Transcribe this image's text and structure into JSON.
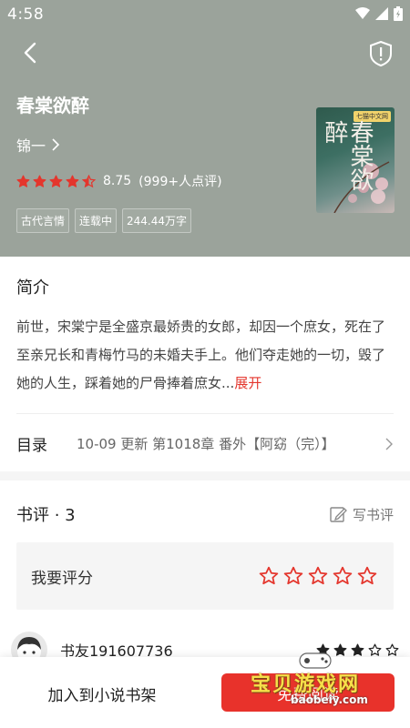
{
  "status": {
    "time": "4:58"
  },
  "book": {
    "title": "春棠欲醉",
    "author": "锦一",
    "score": "8.75",
    "rating_count": "(999+人点评)",
    "stars": 4.5,
    "tags": [
      "古代言情",
      "连载中",
      "244.44万字"
    ],
    "cover": {
      "badge": "七猫中文网",
      "title": "春棠欲醉"
    }
  },
  "intro": {
    "heading": "简介",
    "text": "前世，宋棠宁是全盛京最娇贵的女郎，却因一个庶女，死在了至亲兄长和青梅竹马的未婚夫手上。他们夺走她的一切，毁了她的人生，踩着她的尸骨捧着庶女...",
    "expand": "展开"
  },
  "toc": {
    "label": "目录",
    "latest": "10-09  更新  第1018章 番外【阿窈（完）】"
  },
  "reviews": {
    "title": "书评 · 3",
    "write_label": "写书评",
    "rate_prompt": "我要评分",
    "first_reviewer": {
      "name": "书友191607736",
      "stars": 3
    }
  },
  "bottom": {
    "shelf_label": "加入到小说书架",
    "read_label": "免费阅读"
  },
  "watermark": {
    "text": "宝贝游戏网",
    "url": "baobeiy.com"
  },
  "colors": {
    "header_bg": "#9ba39b",
    "accent": "#e8322b",
    "star_red": "#e4362d"
  }
}
